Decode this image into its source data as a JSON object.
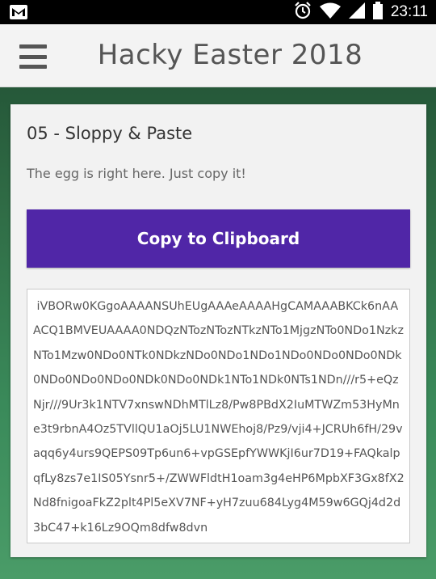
{
  "status_bar": {
    "icons": [
      "gmail-icon",
      "alarm-icon",
      "wifi-icon",
      "signal-icon",
      "battery-icon"
    ],
    "time": "23:11"
  },
  "app_bar": {
    "menu_icon": "hamburger-menu-icon",
    "title": "Hacky Easter 2018"
  },
  "challenge": {
    "title": "05 - Sloppy & Paste",
    "description": "The egg is right here. Just copy it!",
    "copy_button_label": "Copy to Clipboard",
    "egg_text": " iVBORw0KGgoAAAANSUhEUgAAAeAAAAHgCAMAAABKCk6nAAACQ1BMVEUAAAA0NDQzNTozNTozNTkzNTo1MjgzNTo0NDo1NzkzNTo1Mzw0NDo0NTk0NDkzNDo0NDo1NDo1NDo0NDo0NDo0NDk0NDo0NDo0NDo0NDk0NDo0NDk1NTo1NDk0NTs1NDn///r5+eQzNjr///9Ur3k1NTV7xnswNDhMTlLz8/Pw8PBdX2IuMTWZm53HyMne3t9rbnA4Oz5TVllQU1aOj5LU1NWEhoj8/Pz9/vji4+JCRUh6fH/29vaqq6y4urs9QEPS09Tp6un6+vpGSEpfYWWKjI6ur7D19+FAQkalpqfLy8zs7e1IS05Ysnr5+/ZWWFldtH1oam3g4eHP6MpbXF3Gx8fX2Nd8fnigoaFkZ2plt4Pl5eXV7NF+yH7zuu684Lyg4M59w6GQj4d2d3bC47+k16Lz9OQm8dfw8dvn"
  },
  "colors": {
    "status_bar": "#000000",
    "app_bar": "#f3f3f3",
    "button": "#5026a7",
    "card": "#f2f2f2",
    "background_green": "#3a8a5a"
  }
}
